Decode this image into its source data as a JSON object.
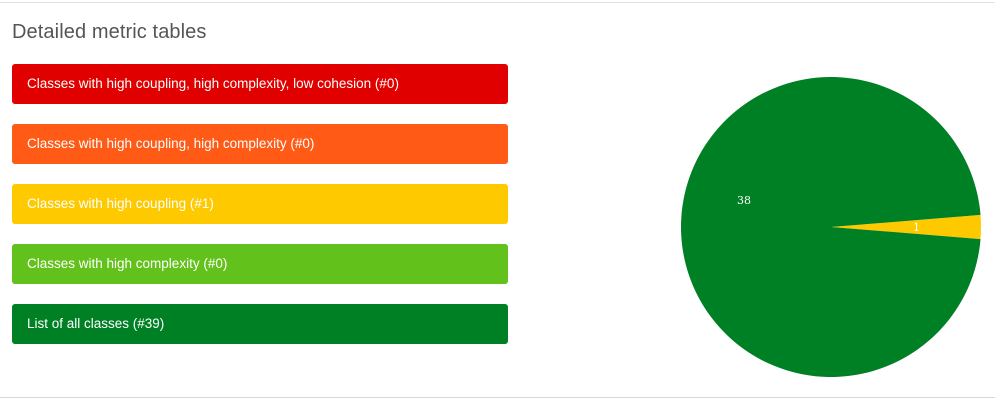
{
  "section": {
    "title": "Detailed metric tables"
  },
  "buttons": [
    {
      "label": "Classes with high coupling, high complexity, low cohesion (#0)",
      "color": "#e00000"
    },
    {
      "label": "Classes with high coupling, high complexity (#0)",
      "color": "#ff5a16"
    },
    {
      "label": "Classes with high coupling (#1)",
      "color": "#ffc900"
    },
    {
      "label": "Classes with high complexity (#0)",
      "color": "#63c11b"
    },
    {
      "label": "List of all classes (#39)",
      "color": "#008025"
    }
  ],
  "chart_data": {
    "type": "pie",
    "slices": [
      {
        "value": 38,
        "label": "38",
        "color": "#008025"
      },
      {
        "value": 1,
        "label": "1",
        "color": "#ffc900"
      }
    ]
  }
}
